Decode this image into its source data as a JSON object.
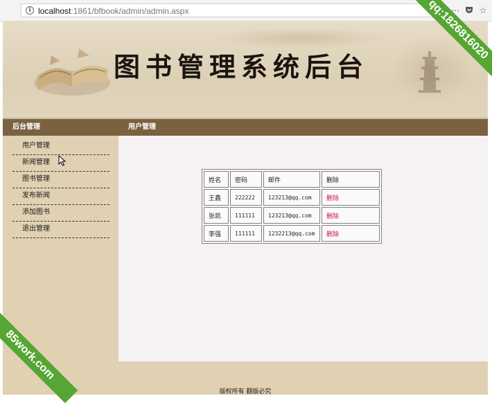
{
  "browser": {
    "url_host": "localhost",
    "url_rest": ":1861/bfbook/admin/admin.aspx",
    "icons": [
      "info-icon",
      "more-icon",
      "pocket-icon",
      "bookmark-star-icon"
    ]
  },
  "banner": {
    "title": "图书管理系统后台"
  },
  "sidebar": {
    "header": "后台管理",
    "items": [
      {
        "label": "用户管理"
      },
      {
        "label": "新闻管理"
      },
      {
        "label": "图书管理"
      },
      {
        "label": "发布新闻"
      },
      {
        "label": "添加图书"
      },
      {
        "label": "退出管理"
      }
    ]
  },
  "main": {
    "header": "用户管理",
    "table": {
      "columns": [
        "姓名",
        "密码",
        "邮件",
        "删除"
      ],
      "rows": [
        {
          "name": "王鑫",
          "password": "222222",
          "email": "123213@qq.com",
          "action": "删除"
        },
        {
          "name": "张凯",
          "password": "111111",
          "email": "123213@qq.com",
          "action": "删除"
        },
        {
          "name": "李强",
          "password": "111111",
          "email": "1232213@qq.com",
          "action": "删除"
        }
      ]
    }
  },
  "footer": {
    "text": "版权所有 翻版必究"
  },
  "watermarks": {
    "top_right": "qq:1826816020",
    "bottom_left": "85work.com"
  },
  "colors": {
    "header_bar": "#7a6240",
    "panel": "#e0d1b3",
    "content": "#f6f2f4",
    "delete_link": "#d0144e",
    "watermark": "#55a633"
  }
}
